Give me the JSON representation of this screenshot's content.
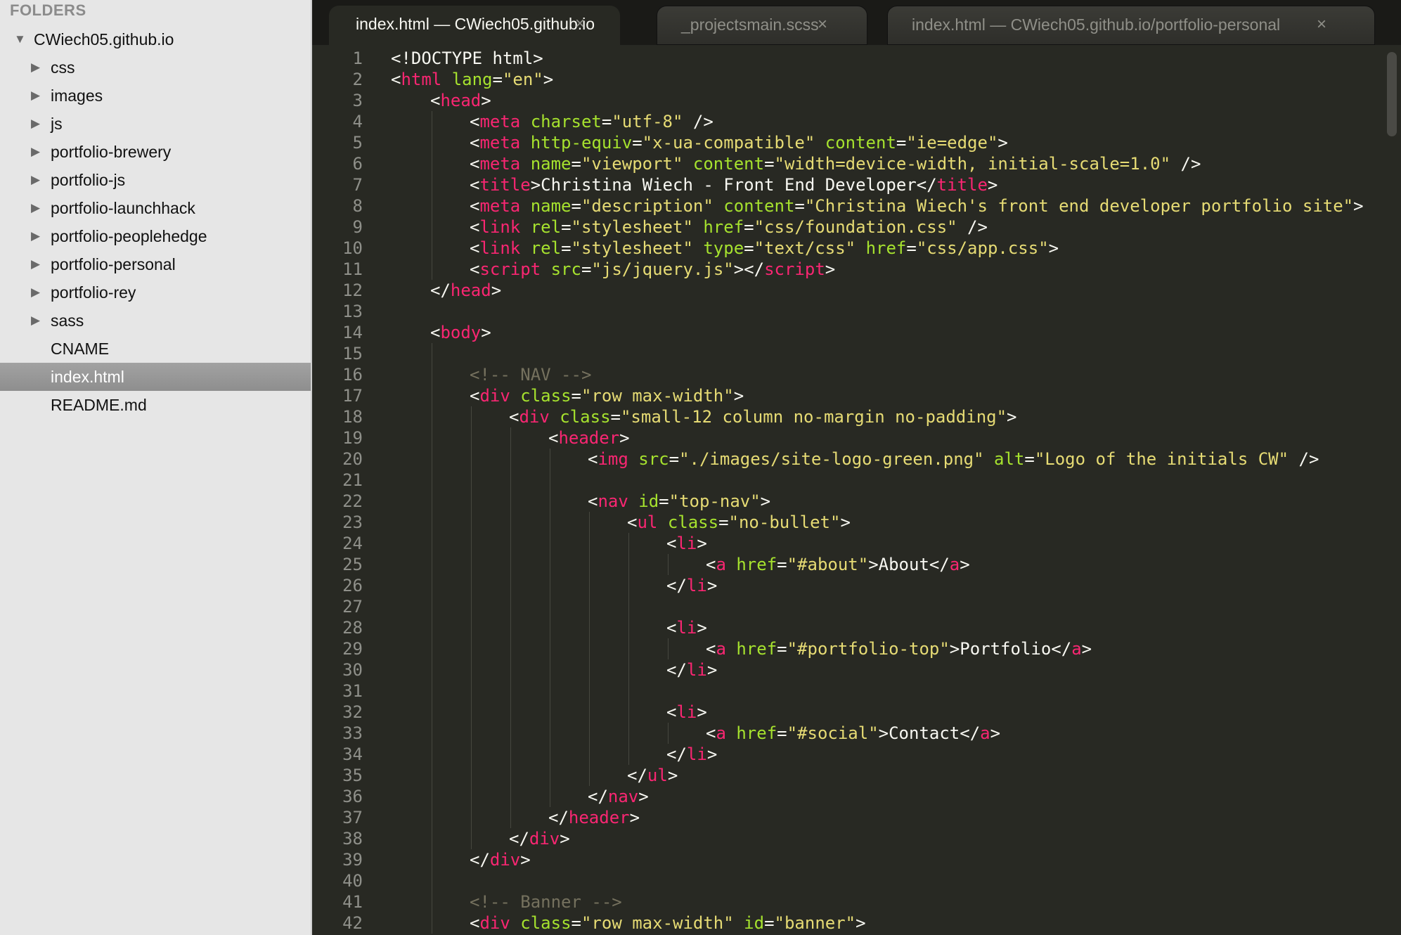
{
  "sidebar": {
    "header": "FOLDERS",
    "items": [
      {
        "label": "CWiech05.github.io",
        "depth": 0,
        "arrow": "▼",
        "selected": false
      },
      {
        "label": "css",
        "depth": 1,
        "arrow": "▶",
        "selected": false
      },
      {
        "label": "images",
        "depth": 1,
        "arrow": "▶",
        "selected": false
      },
      {
        "label": "js",
        "depth": 1,
        "arrow": "▶",
        "selected": false
      },
      {
        "label": "portfolio-brewery",
        "depth": 1,
        "arrow": "▶",
        "selected": false
      },
      {
        "label": "portfolio-js",
        "depth": 1,
        "arrow": "▶",
        "selected": false
      },
      {
        "label": "portfolio-launchhack",
        "depth": 1,
        "arrow": "▶",
        "selected": false
      },
      {
        "label": "portfolio-peoplehedge",
        "depth": 1,
        "arrow": "▶",
        "selected": false
      },
      {
        "label": "portfolio-personal",
        "depth": 1,
        "arrow": "▶",
        "selected": false
      },
      {
        "label": "portfolio-rey",
        "depth": 1,
        "arrow": "▶",
        "selected": false
      },
      {
        "label": "sass",
        "depth": 1,
        "arrow": "▶",
        "selected": false
      },
      {
        "label": "CNAME",
        "depth": 1,
        "arrow": "",
        "selected": false
      },
      {
        "label": "index.html",
        "depth": 1,
        "arrow": "",
        "selected": true
      },
      {
        "label": "README.md",
        "depth": 1,
        "arrow": "",
        "selected": false
      }
    ]
  },
  "tabs": [
    {
      "label": "index.html — CWiech05.github.io",
      "close": "×",
      "active": true
    },
    {
      "label": "_projectsmain.scss",
      "close": "×",
      "active": false
    },
    {
      "label": "index.html — CWiech05.github.io/portfolio-personal",
      "close": "×",
      "active": false
    }
  ],
  "editor": {
    "lines": [
      {
        "n": "1",
        "indent": 0,
        "tokens": [
          [
            "pun",
            "<!DOCTYPE html>"
          ]
        ]
      },
      {
        "n": "2",
        "indent": 0,
        "tokens": [
          [
            "pun",
            "<"
          ],
          [
            "tag",
            "html"
          ],
          [
            "pun",
            " "
          ],
          [
            "attr",
            "lang"
          ],
          [
            "pun",
            "="
          ],
          [
            "str",
            "\"en\""
          ],
          [
            "pun",
            ">"
          ]
        ]
      },
      {
        "n": "3",
        "indent": 1,
        "tokens": [
          [
            "pun",
            "<"
          ],
          [
            "tag",
            "head"
          ],
          [
            "pun",
            ">"
          ]
        ]
      },
      {
        "n": "4",
        "indent": 2,
        "tokens": [
          [
            "pun",
            "<"
          ],
          [
            "tag",
            "meta"
          ],
          [
            "pun",
            " "
          ],
          [
            "attr",
            "charset"
          ],
          [
            "pun",
            "="
          ],
          [
            "str",
            "\"utf-8\""
          ],
          [
            "pun",
            " />"
          ]
        ]
      },
      {
        "n": "5",
        "indent": 2,
        "tokens": [
          [
            "pun",
            "<"
          ],
          [
            "tag",
            "meta"
          ],
          [
            "pun",
            " "
          ],
          [
            "attr",
            "http-equiv"
          ],
          [
            "pun",
            "="
          ],
          [
            "str",
            "\"x-ua-compatible\""
          ],
          [
            "pun",
            " "
          ],
          [
            "attr",
            "content"
          ],
          [
            "pun",
            "="
          ],
          [
            "str",
            "\"ie=edge\""
          ],
          [
            "pun",
            ">"
          ]
        ]
      },
      {
        "n": "6",
        "indent": 2,
        "tokens": [
          [
            "pun",
            "<"
          ],
          [
            "tag",
            "meta"
          ],
          [
            "pun",
            " "
          ],
          [
            "attr",
            "name"
          ],
          [
            "pun",
            "="
          ],
          [
            "str",
            "\"viewport\""
          ],
          [
            "pun",
            " "
          ],
          [
            "attr",
            "content"
          ],
          [
            "pun",
            "="
          ],
          [
            "str",
            "\"width=device-width, initial-scale=1.0\""
          ],
          [
            "pun",
            " />"
          ]
        ]
      },
      {
        "n": "7",
        "indent": 2,
        "tokens": [
          [
            "pun",
            "<"
          ],
          [
            "tag",
            "title"
          ],
          [
            "pun",
            ">Christina Wiech - Front End Developer</"
          ],
          [
            "tag",
            "title"
          ],
          [
            "pun",
            ">"
          ]
        ]
      },
      {
        "n": "8",
        "indent": 2,
        "tokens": [
          [
            "pun",
            "<"
          ],
          [
            "tag",
            "meta"
          ],
          [
            "pun",
            " "
          ],
          [
            "attr",
            "name"
          ],
          [
            "pun",
            "="
          ],
          [
            "str",
            "\"description\""
          ],
          [
            "pun",
            " "
          ],
          [
            "attr",
            "content"
          ],
          [
            "pun",
            "="
          ],
          [
            "str",
            "\"Christina Wiech's front end developer portfolio site\""
          ],
          [
            "pun",
            ">"
          ]
        ]
      },
      {
        "n": "9",
        "indent": 2,
        "tokens": [
          [
            "pun",
            "<"
          ],
          [
            "tag",
            "link"
          ],
          [
            "pun",
            " "
          ],
          [
            "attr",
            "rel"
          ],
          [
            "pun",
            "="
          ],
          [
            "str",
            "\"stylesheet\""
          ],
          [
            "pun",
            " "
          ],
          [
            "attr",
            "href"
          ],
          [
            "pun",
            "="
          ],
          [
            "str",
            "\"css/foundation.css\""
          ],
          [
            "pun",
            " />"
          ]
        ]
      },
      {
        "n": "10",
        "indent": 2,
        "tokens": [
          [
            "pun",
            "<"
          ],
          [
            "tag",
            "link"
          ],
          [
            "pun",
            " "
          ],
          [
            "attr",
            "rel"
          ],
          [
            "pun",
            "="
          ],
          [
            "str",
            "\"stylesheet\""
          ],
          [
            "pun",
            " "
          ],
          [
            "attr",
            "type"
          ],
          [
            "pun",
            "="
          ],
          [
            "str",
            "\"text/css\""
          ],
          [
            "pun",
            " "
          ],
          [
            "attr",
            "href"
          ],
          [
            "pun",
            "="
          ],
          [
            "str",
            "\"css/app.css\""
          ],
          [
            "pun",
            ">"
          ]
        ]
      },
      {
        "n": "11",
        "indent": 2,
        "tokens": [
          [
            "pun",
            "<"
          ],
          [
            "tag",
            "script"
          ],
          [
            "pun",
            " "
          ],
          [
            "attr",
            "src"
          ],
          [
            "pun",
            "="
          ],
          [
            "str",
            "\"js/jquery.js\""
          ],
          [
            "pun",
            "></"
          ],
          [
            "tag",
            "script"
          ],
          [
            "pun",
            ">"
          ]
        ]
      },
      {
        "n": "12",
        "indent": 1,
        "tokens": [
          [
            "pun",
            "</"
          ],
          [
            "tag",
            "head"
          ],
          [
            "pun",
            ">"
          ]
        ]
      },
      {
        "n": "13",
        "indent": 0,
        "tokens": []
      },
      {
        "n": "14",
        "indent": 1,
        "tokens": [
          [
            "pun",
            "<"
          ],
          [
            "tag",
            "body"
          ],
          [
            "pun",
            ">"
          ]
        ]
      },
      {
        "n": "15",
        "indent": 0,
        "tokens": []
      },
      {
        "n": "16",
        "indent": 2,
        "tokens": [
          [
            "cmt",
            "<!-- NAV -->"
          ]
        ]
      },
      {
        "n": "17",
        "indent": 2,
        "tokens": [
          [
            "pun",
            "<"
          ],
          [
            "tag",
            "div"
          ],
          [
            "pun",
            " "
          ],
          [
            "attr",
            "class"
          ],
          [
            "pun",
            "="
          ],
          [
            "str",
            "\"row max-width\""
          ],
          [
            "pun",
            ">"
          ]
        ]
      },
      {
        "n": "18",
        "indent": 3,
        "tokens": [
          [
            "pun",
            "<"
          ],
          [
            "tag",
            "div"
          ],
          [
            "pun",
            " "
          ],
          [
            "attr",
            "class"
          ],
          [
            "pun",
            "="
          ],
          [
            "str",
            "\"small-12 column no-margin no-padding\""
          ],
          [
            "pun",
            ">"
          ]
        ]
      },
      {
        "n": "19",
        "indent": 4,
        "tokens": [
          [
            "pun",
            "<"
          ],
          [
            "tag",
            "header"
          ],
          [
            "pun",
            ">"
          ]
        ]
      },
      {
        "n": "20",
        "indent": 5,
        "tokens": [
          [
            "pun",
            "<"
          ],
          [
            "tag",
            "img"
          ],
          [
            "pun",
            " "
          ],
          [
            "attr",
            "src"
          ],
          [
            "pun",
            "="
          ],
          [
            "str",
            "\"./images/site-logo-green.png\""
          ],
          [
            "pun",
            " "
          ],
          [
            "attr",
            "alt"
          ],
          [
            "pun",
            "="
          ],
          [
            "str",
            "\"Logo of the initials CW\""
          ],
          [
            "pun",
            " />"
          ]
        ]
      },
      {
        "n": "21",
        "indent": 0,
        "tokens": []
      },
      {
        "n": "22",
        "indent": 5,
        "tokens": [
          [
            "pun",
            "<"
          ],
          [
            "tag",
            "nav"
          ],
          [
            "pun",
            " "
          ],
          [
            "attr",
            "id"
          ],
          [
            "pun",
            "="
          ],
          [
            "str",
            "\"top-nav\""
          ],
          [
            "pun",
            ">"
          ]
        ]
      },
      {
        "n": "23",
        "indent": 6,
        "tokens": [
          [
            "pun",
            "<"
          ],
          [
            "tag",
            "ul"
          ],
          [
            "pun",
            " "
          ],
          [
            "attr",
            "class"
          ],
          [
            "pun",
            "="
          ],
          [
            "str",
            "\"no-bullet\""
          ],
          [
            "pun",
            ">"
          ]
        ]
      },
      {
        "n": "24",
        "indent": 7,
        "tokens": [
          [
            "pun",
            "<"
          ],
          [
            "tag",
            "li"
          ],
          [
            "pun",
            ">"
          ]
        ]
      },
      {
        "n": "25",
        "indent": 8,
        "tokens": [
          [
            "pun",
            "<"
          ],
          [
            "tag",
            "a"
          ],
          [
            "pun",
            " "
          ],
          [
            "attr",
            "href"
          ],
          [
            "pun",
            "="
          ],
          [
            "str",
            "\"#about\""
          ],
          [
            "pun",
            ">About</"
          ],
          [
            "tag",
            "a"
          ],
          [
            "pun",
            ">"
          ]
        ]
      },
      {
        "n": "26",
        "indent": 7,
        "tokens": [
          [
            "pun",
            "</"
          ],
          [
            "tag",
            "li"
          ],
          [
            "pun",
            ">"
          ]
        ]
      },
      {
        "n": "27",
        "indent": 0,
        "tokens": []
      },
      {
        "n": "28",
        "indent": 7,
        "tokens": [
          [
            "pun",
            "<"
          ],
          [
            "tag",
            "li"
          ],
          [
            "pun",
            ">"
          ]
        ]
      },
      {
        "n": "29",
        "indent": 8,
        "tokens": [
          [
            "pun",
            "<"
          ],
          [
            "tag",
            "a"
          ],
          [
            "pun",
            " "
          ],
          [
            "attr",
            "href"
          ],
          [
            "pun",
            "="
          ],
          [
            "str",
            "\"#portfolio-top\""
          ],
          [
            "pun",
            ">Portfolio</"
          ],
          [
            "tag",
            "a"
          ],
          [
            "pun",
            ">"
          ]
        ]
      },
      {
        "n": "30",
        "indent": 7,
        "tokens": [
          [
            "pun",
            "</"
          ],
          [
            "tag",
            "li"
          ],
          [
            "pun",
            ">"
          ]
        ]
      },
      {
        "n": "31",
        "indent": 0,
        "tokens": []
      },
      {
        "n": "32",
        "indent": 7,
        "tokens": [
          [
            "pun",
            "<"
          ],
          [
            "tag",
            "li"
          ],
          [
            "pun",
            ">"
          ]
        ]
      },
      {
        "n": "33",
        "indent": 8,
        "tokens": [
          [
            "pun",
            "<"
          ],
          [
            "tag",
            "a"
          ],
          [
            "pun",
            " "
          ],
          [
            "attr",
            "href"
          ],
          [
            "pun",
            "="
          ],
          [
            "str",
            "\"#social\""
          ],
          [
            "pun",
            ">Contact</"
          ],
          [
            "tag",
            "a"
          ],
          [
            "pun",
            ">"
          ]
        ]
      },
      {
        "n": "34",
        "indent": 7,
        "tokens": [
          [
            "pun",
            "</"
          ],
          [
            "tag",
            "li"
          ],
          [
            "pun",
            ">"
          ]
        ]
      },
      {
        "n": "35",
        "indent": 6,
        "tokens": [
          [
            "pun",
            "</"
          ],
          [
            "tag",
            "ul"
          ],
          [
            "pun",
            ">"
          ]
        ]
      },
      {
        "n": "36",
        "indent": 5,
        "tokens": [
          [
            "pun",
            "</"
          ],
          [
            "tag",
            "nav"
          ],
          [
            "pun",
            ">"
          ]
        ]
      },
      {
        "n": "37",
        "indent": 4,
        "tokens": [
          [
            "pun",
            "</"
          ],
          [
            "tag",
            "header"
          ],
          [
            "pun",
            ">"
          ]
        ]
      },
      {
        "n": "38",
        "indent": 3,
        "tokens": [
          [
            "pun",
            "</"
          ],
          [
            "tag",
            "div"
          ],
          [
            "pun",
            ">"
          ]
        ]
      },
      {
        "n": "39",
        "indent": 2,
        "tokens": [
          [
            "pun",
            "</"
          ],
          [
            "tag",
            "div"
          ],
          [
            "pun",
            ">"
          ]
        ]
      },
      {
        "n": "40",
        "indent": 0,
        "tokens": []
      },
      {
        "n": "41",
        "indent": 2,
        "tokens": [
          [
            "cmt",
            "<!-- Banner -->"
          ]
        ]
      },
      {
        "n": "42",
        "indent": 2,
        "tokens": [
          [
            "pun",
            "<"
          ],
          [
            "tag",
            "div"
          ],
          [
            "pun",
            " "
          ],
          [
            "attr",
            "class"
          ],
          [
            "pun",
            "="
          ],
          [
            "str",
            "\"row max-width\""
          ],
          [
            "pun",
            " "
          ],
          [
            "attr",
            "id"
          ],
          [
            "pun",
            "="
          ],
          [
            "str",
            "\"banner\""
          ],
          [
            "pun",
            ">"
          ]
        ]
      }
    ]
  },
  "colors": {
    "editor_bg": "#282923",
    "tag": "#f92672",
    "attribute": "#a6e22e",
    "string": "#e6db74",
    "comment": "#75715e",
    "text": "#f8f8f2",
    "line_number": "#8f908a",
    "sidebar_bg": "#e6e6e6",
    "sidebar_selected": "#9a9a9a"
  }
}
